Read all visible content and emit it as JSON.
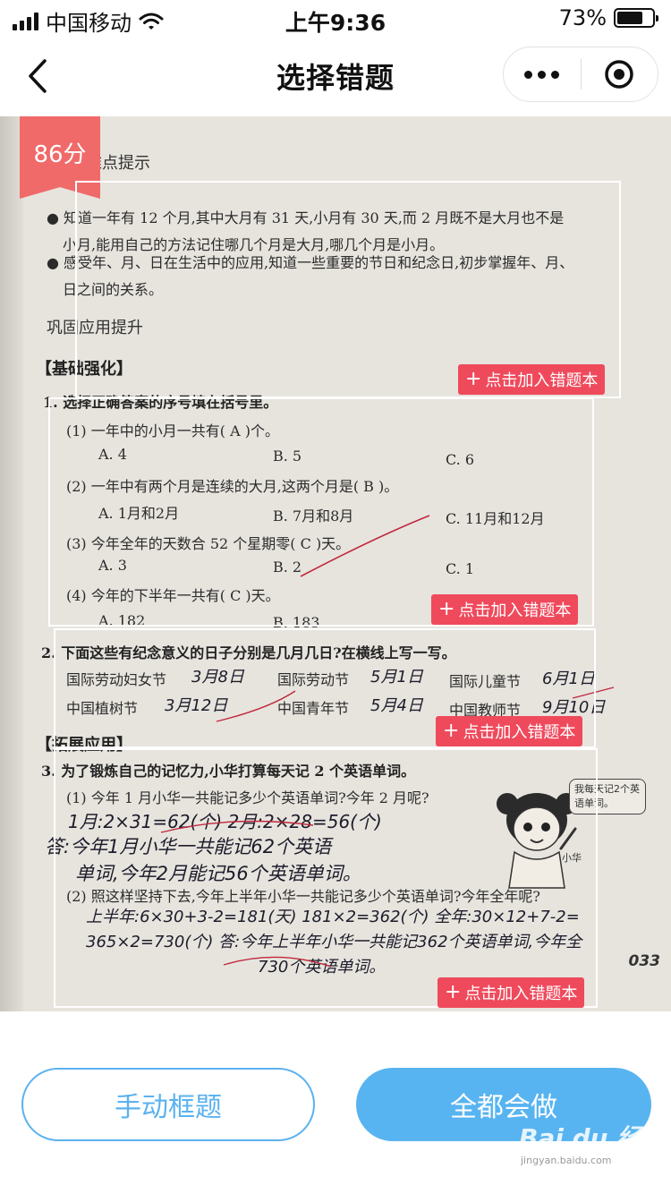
{
  "status_bar": {
    "carrier": "中国移动",
    "time": "上午9:36",
    "battery_percent": "73%",
    "battery_level": 0.73
  },
  "nav": {
    "title": "选择错题",
    "back_icon": "chevron-left-icon",
    "more_icon": "more-dots-icon",
    "close_icon": "target-icon"
  },
  "score_badge": "86分",
  "worksheet": {
    "section_hint": "难点提示",
    "bullet1_line1": "● 知道一年有 12 个月,其中大月有 31 天,小月有 30 天,而 2 月既不是大月也不是",
    "bullet1_line2": "小月,能用自己的方法记住哪几个月是大月,哪几个月是小月。",
    "bullet2_line1": "● 感受年、月、日在生活中的应用,知道一些重要的节日和纪念日,初步掌握年、月、",
    "bullet2_line2": "日之间的关系。",
    "section_consolidate": "巩固应用提升",
    "section_basic": "【基础强化】",
    "q1_title": "1. 选择正确答案的序号填在括号里。",
    "q1_1": "(1) 一年中的小月一共有(  A  )个。",
    "q1_1_opts": [
      "A. 4",
      "B. 5",
      "C. 6"
    ],
    "q1_2": "(2) 一年中有两个月是连续的大月,这两个月是(  B  )。",
    "q1_2_opts": [
      "A. 1月和2月",
      "B. 7月和8月",
      "C. 11月和12月"
    ],
    "q1_3": "(3) 今年全年的天数合 52 个星期零(  C  )天。",
    "q1_3_opts": [
      "A. 3",
      "B. 2",
      "C. 1"
    ],
    "q1_4": "(4) 今年的下半年一共有(  C  )天。",
    "q1_4_opts": [
      "A. 182",
      "B. 183"
    ],
    "q2_title": "2. 下面这些有纪念意义的日子分别是几月几日?在横线上写一写。",
    "q2_row1": [
      "国际劳动妇女节",
      "3月8日",
      "国际劳动节",
      "5月1日",
      "国际儿童节",
      "6月1日"
    ],
    "q2_row2": [
      "中国植树节",
      "3月12日",
      "中国青年节",
      "5月4日",
      "中国教师节",
      "9月10日"
    ],
    "section_extend": "【拓展应用】",
    "q3_title": "3. 为了锻炼自己的记忆力,小华打算每天记 2 个英语单词。",
    "q3_1": "(1) 今年 1 月小华一共能记多少个英语单词?今年 2 月呢?",
    "q3_1_hand1": "1月:2×31=62(个) 2月:2×28=56(个)",
    "q3_1_hand2": "答:今年1月小华一共能记62个英语",
    "q3_1_hand3": "单词,今年2月能记56个英语单词。",
    "q3_bubble": "我每天记2个英语单词。",
    "q3_character": "小华",
    "q3_2": "(2) 照这样坚持下去,今年上半年小华一共能记多少个英语单词?今年全年呢?",
    "q3_2_hand1": "上半年:6×30+3-2=181(天) 181×2=362(个) 全年:30×12+7-2=",
    "q3_2_hand2": "365×2=730(个) 答:今年上半年小华一共能记362个英语单词,今年全",
    "q3_2_hand3": "730个英语单词。",
    "page_number": "033"
  },
  "add_button_label": "点击加入错题本",
  "bottom": {
    "manual_label": "手动框题",
    "all_correct_label": "全都会做"
  },
  "watermark": {
    "brand": "Bai du 经验",
    "url": "jingyan.baidu.com"
  }
}
